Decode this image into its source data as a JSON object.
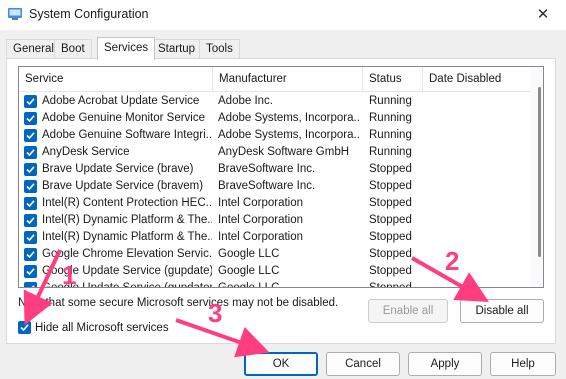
{
  "window": {
    "title": "System Configuration",
    "close_glyph": "✕"
  },
  "tabs": [
    {
      "label": "General"
    },
    {
      "label": "Boot"
    },
    {
      "label": "Services",
      "active": true
    },
    {
      "label": "Startup"
    },
    {
      "label": "Tools"
    }
  ],
  "services_table": {
    "columns": [
      "Service",
      "Manufacturer",
      "Status",
      "Date Disabled"
    ],
    "rows": [
      {
        "checked": true,
        "service": "Adobe Acrobat Update Service",
        "manufacturer": "Adobe Inc.",
        "status": "Running",
        "date_disabled": ""
      },
      {
        "checked": true,
        "service": "Adobe Genuine Monitor Service",
        "manufacturer": "Adobe Systems, Incorpora...",
        "status": "Running",
        "date_disabled": ""
      },
      {
        "checked": true,
        "service": "Adobe Genuine Software Integri...",
        "manufacturer": "Adobe Systems, Incorpora...",
        "status": "Running",
        "date_disabled": ""
      },
      {
        "checked": true,
        "service": "AnyDesk Service",
        "manufacturer": "AnyDesk Software GmbH",
        "status": "Running",
        "date_disabled": ""
      },
      {
        "checked": true,
        "service": "Brave Update Service (brave)",
        "manufacturer": "BraveSoftware Inc.",
        "status": "Stopped",
        "date_disabled": ""
      },
      {
        "checked": true,
        "service": "Brave Update Service (bravem)",
        "manufacturer": "BraveSoftware Inc.",
        "status": "Stopped",
        "date_disabled": ""
      },
      {
        "checked": true,
        "service": "Intel(R) Content Protection HEC...",
        "manufacturer": "Intel Corporation",
        "status": "Stopped",
        "date_disabled": ""
      },
      {
        "checked": true,
        "service": "Intel(R) Dynamic Platform & The...",
        "manufacturer": "Intel Corporation",
        "status": "Stopped",
        "date_disabled": ""
      },
      {
        "checked": true,
        "service": "Intel(R) Dynamic Platform & The...",
        "manufacturer": "Intel Corporation",
        "status": "Stopped",
        "date_disabled": ""
      },
      {
        "checked": true,
        "service": "Google Chrome Elevation Servic...",
        "manufacturer": "Google LLC",
        "status": "Stopped",
        "date_disabled": ""
      },
      {
        "checked": true,
        "service": "Google Update Service (gupdate)",
        "manufacturer": "Google LLC",
        "status": "Stopped",
        "date_disabled": ""
      },
      {
        "checked": true,
        "service": "Google Update Service (gupdatem)",
        "manufacturer": "Google LLC",
        "status": "Stopped",
        "date_disabled": ""
      }
    ]
  },
  "note": "Note that some secure Microsoft services may not be disabled.",
  "enable_all_label": "Enable all",
  "disable_all_label": "Disable all",
  "hide_ms": {
    "label": "Hide all Microsoft services",
    "checked": true
  },
  "footer_buttons": {
    "ok": "OK",
    "cancel": "Cancel",
    "apply": "Apply",
    "help": "Help"
  },
  "annotations": {
    "numbers": [
      "1",
      "2",
      "3"
    ],
    "color": "#ff3d7f"
  },
  "colors": {
    "accent": "#0067c0"
  }
}
